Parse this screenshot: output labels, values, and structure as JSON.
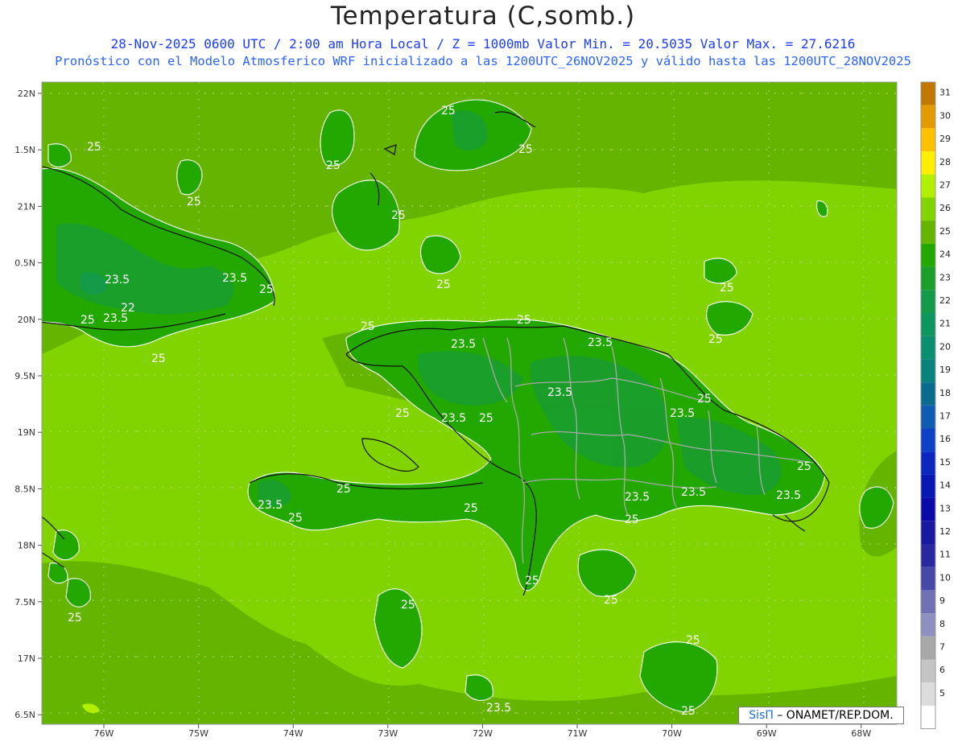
{
  "header": {
    "title": "Temperatura (C,somb.)",
    "line1": "28-Nov-2025  0600 UTC / 2:00 am Hora Local / Z = 1000mb   Valor Min. = 20.5035  Valor Max. = 27.6216",
    "line2": "Pronóstico con el Modelo Atmosferico WRF inicializado a las 1200UTC_26NOV2025 y válido hasta las  1200UTC_28NOV2025"
  },
  "axes": {
    "lat_labels": [
      "22N",
      "1.5N",
      "21N",
      "0.5N",
      "20N",
      "9.5N",
      "19N",
      "8.5N",
      "18N",
      "7.5N",
      "17N",
      "6.5N"
    ],
    "lon_labels": [
      "76W",
      "75W",
      "74W",
      "73W",
      "72W",
      "71W",
      "70W",
      "69W",
      "68W"
    ]
  },
  "colorbar": {
    "labels": [
      "31",
      "30",
      "29",
      "28",
      "27",
      "26",
      "25",
      "24",
      "23",
      "22",
      "21",
      "20",
      "19",
      "18",
      "17",
      "16",
      "15",
      "14",
      "13",
      "12",
      "11",
      "10",
      "9",
      "8",
      "7",
      "6",
      "5"
    ],
    "colors": [
      "#c07800",
      "#e49a00",
      "#ffc000",
      "#ffee00",
      "#b0f000",
      "#82d400",
      "#64b400",
      "#22a800",
      "#1a9e2c",
      "#149a48",
      "#0e9660",
      "#0a9070",
      "#08847c",
      "#0a6c8c",
      "#0f5cb0",
      "#0e40c8",
      "#0a28c0",
      "#0818b4",
      "#0a0aa8",
      "#1818a0",
      "#2828a0",
      "#4848a8",
      "#7070b4",
      "#9090c0",
      "#a8a8a8",
      "#c4c4c4",
      "#dcdcdc",
      "#ffffff"
    ]
  },
  "contour_labels": [
    {
      "text": "25"
    },
    {
      "text": "25"
    },
    {
      "text": "25"
    },
    {
      "text": "25"
    },
    {
      "text": "25"
    },
    {
      "text": "25"
    },
    {
      "text": "25"
    },
    {
      "text": "25"
    },
    {
      "text": "23.5"
    },
    {
      "text": "23.5"
    },
    {
      "text": "23.5"
    },
    {
      "text": "22"
    },
    {
      "text": "25"
    },
    {
      "text": "25"
    },
    {
      "text": "25"
    },
    {
      "text": "25"
    },
    {
      "text": "25"
    },
    {
      "text": "23.5"
    },
    {
      "text": "23.5"
    },
    {
      "text": "23.5"
    },
    {
      "text": "23.5"
    },
    {
      "text": "25"
    },
    {
      "text": "23.5"
    },
    {
      "text": "25"
    },
    {
      "text": "25"
    },
    {
      "text": "23.5"
    },
    {
      "text": "25"
    },
    {
      "text": "25"
    },
    {
      "text": "23.5"
    },
    {
      "text": "25"
    },
    {
      "text": "25"
    },
    {
      "text": "25"
    },
    {
      "text": "23.5"
    },
    {
      "text": "23.5"
    },
    {
      "text": "25"
    },
    {
      "text": "25"
    },
    {
      "text": "25"
    },
    {
      "text": "25"
    },
    {
      "text": "25"
    },
    {
      "text": "25"
    },
    {
      "text": "25"
    },
    {
      "text": "23.5"
    }
  ],
  "credit": {
    "brand": "SisΠ",
    "text": " – ONAMET/REP.DOM."
  }
}
